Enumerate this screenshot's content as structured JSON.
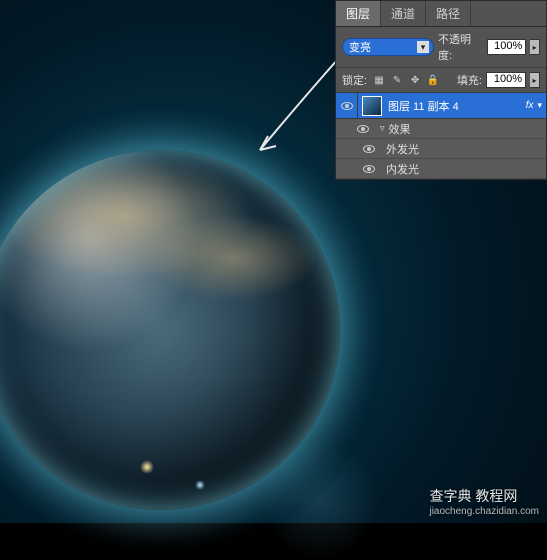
{
  "panel": {
    "tabs": {
      "layers": "图层",
      "channels": "通道",
      "paths": "路径"
    },
    "blend_mode": "变亮",
    "opacity_label": "不透明度:",
    "opacity_value": "100%",
    "lock_label": "锁定:",
    "fill_label": "填充:",
    "fill_value": "100%"
  },
  "layer": {
    "name": "图层 11 副本 4",
    "fx_label": "fx"
  },
  "effects": {
    "header": "效果",
    "outer_glow": "外发光",
    "inner_glow": "内发光"
  },
  "watermark": {
    "main": "查字典 教程网",
    "sub": "jiaocheng.chazidian.com"
  }
}
